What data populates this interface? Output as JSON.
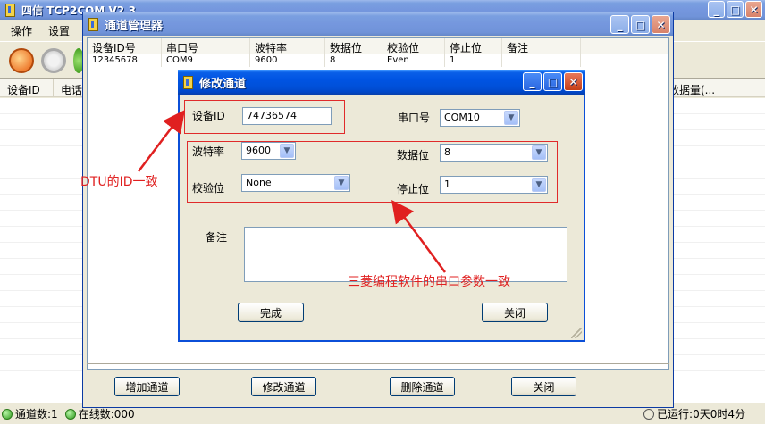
{
  "main": {
    "title": "四信 TCP2COM V2.3",
    "menu": [
      "操作",
      "设置"
    ],
    "columns": [
      "设备ID",
      "电话",
      "数据量(..."
    ],
    "status": {
      "channels": "通道数:1",
      "online": "在线数:000",
      "runtime": "已运行:0天0时4分"
    }
  },
  "channel_manager": {
    "title": "通道管理器",
    "columns": [
      "设备ID号",
      "串口号",
      "波特率",
      "数据位",
      "校验位",
      "停止位",
      "备注"
    ],
    "rows": [
      [
        "12345678",
        "COM9",
        "9600",
        "8",
        "Even",
        "1",
        ""
      ]
    ],
    "buttons": {
      "add": "增加通道",
      "modify": "修改通道",
      "delete": "删除通道",
      "close": "关闭"
    }
  },
  "edit_dialog": {
    "title": "修改通道",
    "device_id_label": "设备ID",
    "device_id_value": "74736574",
    "port_label": "串口号",
    "port_value": "COM10",
    "baud_label": "波特率",
    "baud_value": "9600",
    "databits_label": "数据位",
    "databits_value": "8",
    "parity_label": "校验位",
    "parity_value": "None",
    "stopbits_label": "停止位",
    "stopbits_value": "1",
    "remark_label": "备注",
    "remark_value": "",
    "ok_button": "完成",
    "close_button": "关闭"
  },
  "annotations": {
    "dtu_note": "DTU的ID一致",
    "serial_note": "三菱编程软件的串口参数一致",
    "color": "#e02020"
  }
}
